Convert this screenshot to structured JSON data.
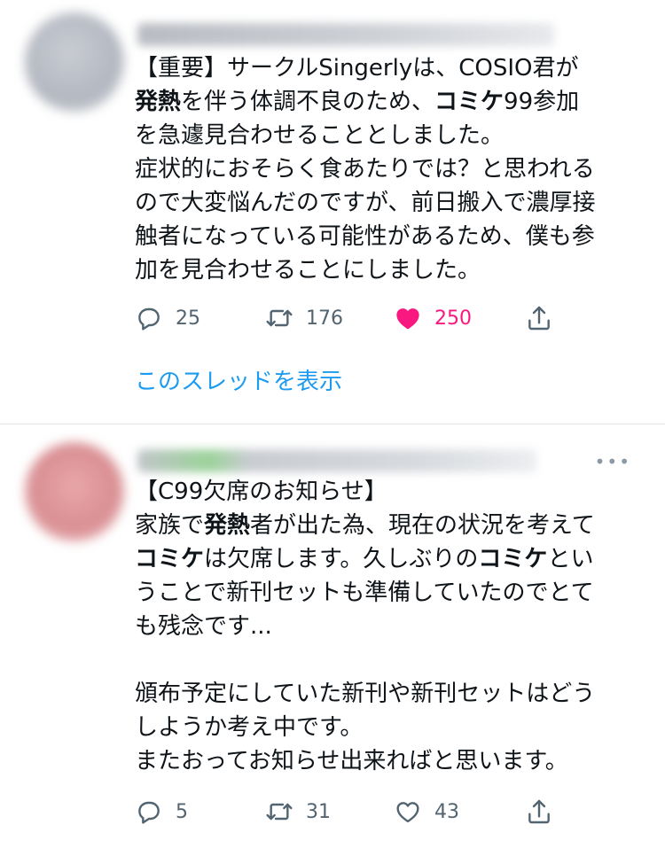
{
  "tweets": [
    {
      "avatar": "blurred-avatar",
      "meta": "blurred-name-and-handle",
      "text_lines": [
        [
          {
            "t": "【重要】サークルSingerlyは、COSIO君が"
          }
        ],
        [
          {
            "t": "発熱",
            "b": true
          },
          {
            "t": "を伴う体調不良のため、"
          },
          {
            "t": "コミケ",
            "b": true
          },
          {
            "t": "99参加"
          }
        ],
        [
          {
            "t": "を急遽見合わせることとしました。"
          }
        ],
        [
          {
            "t": "症状的におそらく食あたりでは？と思われる"
          }
        ],
        [
          {
            "t": "ので大変悩んだのですが、前日搬入で濃厚接"
          }
        ],
        [
          {
            "t": "触者になっている可能性があるため、僕も参"
          }
        ],
        [
          {
            "t": "加を見合わせることにしました。"
          }
        ]
      ],
      "actions": {
        "reply": {
          "icon": "reply-icon",
          "count": "25"
        },
        "retweet": {
          "icon": "retweet-icon",
          "count": "176"
        },
        "like": {
          "icon": "heart-filled-icon",
          "count": "250",
          "color": "#f91880"
        },
        "share": {
          "icon": "share-icon"
        }
      },
      "thread_link": "このスレッドを表示"
    },
    {
      "avatar": "blurred-avatar",
      "meta": "blurred-name-and-handle",
      "more_icon": "more-icon",
      "text_lines": [
        [
          {
            "t": "【C99欠席のお知らせ】"
          }
        ],
        [
          {
            "t": "家族で"
          },
          {
            "t": "発熱",
            "b": true
          },
          {
            "t": "者が出た為、現在の状況を考えて"
          }
        ],
        [
          {
            "t": "コミケ",
            "b": true
          },
          {
            "t": "は欠席します。久しぶりの"
          },
          {
            "t": "コミケ",
            "b": true
          },
          {
            "t": "とい"
          }
        ],
        [
          {
            "t": "うことで新刊セットも準備していたのでとて"
          }
        ],
        [
          {
            "t": "も残念です..."
          }
        ],
        [
          {
            "t": ""
          }
        ],
        [
          {
            "t": "頒布予定にしていた新刊や新刊セットはどう"
          }
        ],
        [
          {
            "t": "しようか考え中です。"
          }
        ],
        [
          {
            "t": "またおってお知らせ出来ればと思います。"
          }
        ]
      ],
      "actions": {
        "reply": {
          "icon": "reply-icon",
          "count": "5"
        },
        "retweet": {
          "icon": "retweet-icon",
          "count": "31"
        },
        "like": {
          "icon": "heart-outline-icon",
          "count": "43"
        },
        "share": {
          "icon": "share-icon"
        }
      }
    }
  ],
  "colors": {
    "accent": "#1d9bf0",
    "like": "#f91880",
    "icon_gray": "#536471"
  }
}
